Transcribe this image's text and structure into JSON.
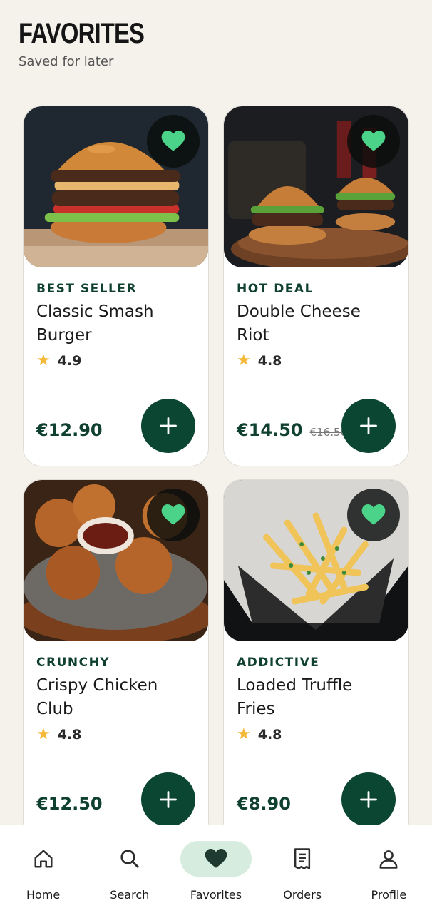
{
  "header": {
    "title": "FAVORITES",
    "subtitle": "Saved for later"
  },
  "colors": {
    "accent": "#0b4632",
    "heart": "#4cd38a",
    "star": "#f5b93a",
    "background": "#f5f2ec"
  },
  "cards": [
    {
      "tag": "BEST SELLER",
      "name": "Classic Smash Burger",
      "rating": "4.9",
      "price": "€12.90",
      "old_price": "",
      "image": "burger-photo",
      "favorite": true
    },
    {
      "tag": "HOT DEAL",
      "name": "Double Cheese Riot",
      "rating": "4.8",
      "price": "€14.50",
      "old_price": "€16.50",
      "image": "double-burger-photo",
      "favorite": true
    },
    {
      "tag": "CRUNCHY",
      "name": "Crispy Chicken Club",
      "rating": "4.8",
      "price": "€12.50",
      "old_price": "",
      "image": "fried-chicken-photo",
      "favorite": true
    },
    {
      "tag": "ADDICTIVE",
      "name": "Loaded Truffle Fries",
      "rating": "4.8",
      "price": "€8.90",
      "old_price": "",
      "image": "truffle-fries-photo",
      "favorite": true
    }
  ],
  "nav": [
    {
      "label": "Home",
      "icon": "home-icon",
      "active": false
    },
    {
      "label": "Search",
      "icon": "search-icon",
      "active": false
    },
    {
      "label": "Favorites",
      "icon": "heart-icon",
      "active": true
    },
    {
      "label": "Orders",
      "icon": "receipt-icon",
      "active": false
    },
    {
      "label": "Profile",
      "icon": "user-icon",
      "active": false
    }
  ]
}
